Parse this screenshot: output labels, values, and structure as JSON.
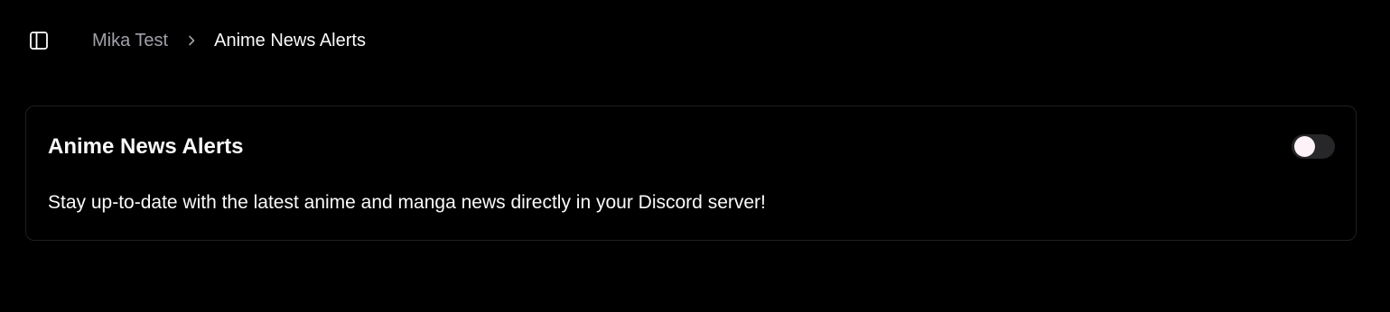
{
  "header": {
    "sidebar_toggle_icon": "panel-left-icon",
    "breadcrumb": {
      "parent": "Mika Test",
      "separator_icon": "chevron-right-icon",
      "current": "Anime News Alerts"
    }
  },
  "card": {
    "title": "Anime News Alerts",
    "description": "Stay up-to-date with the latest anime and manga news directly in your Discord server!",
    "toggle": {
      "enabled": false
    }
  },
  "colors": {
    "background": "#000000",
    "muted_text": "#a1a1aa",
    "text": "#fafafa",
    "card_border": "#1f1f23",
    "toggle_track": "#27272a",
    "toggle_knob": "#fdf2f8"
  }
}
